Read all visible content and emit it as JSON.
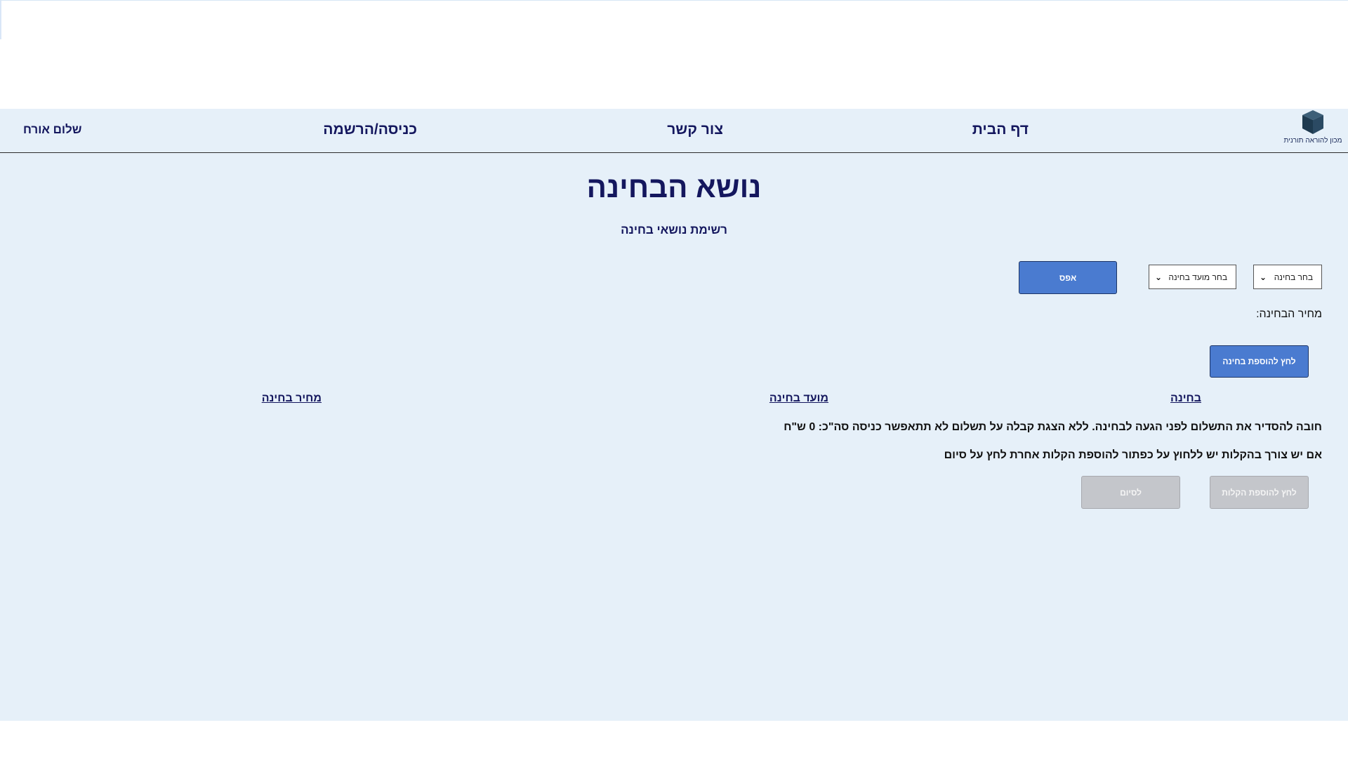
{
  "header": {
    "logo_text": "מכון להוראה תורנית",
    "nav": {
      "home": "דף הבית",
      "contact": "צור קשר",
      "login": "כניסה/הרשמה"
    },
    "greeting": "שלום אורח"
  },
  "main": {
    "title": "נושא הבחינה",
    "subtitle": "רשימת נושאי בחינה",
    "select_exam": {
      "value": "בחר בחינה"
    },
    "select_date": {
      "value": "בחר מועד בחינה"
    },
    "reset_label": "אפס",
    "price_label": "מחיר הבחינה:",
    "add_exam_label": "לחץ להוספת בחינה",
    "columns": [
      "בחינה",
      "מועד בחינה",
      "מחיר בחינה"
    ],
    "payment_notice": "חובה להסדיר את התשלום לפני הגעה לבחינה. ללא הצגת קבלה על תשלום לא תתאפשר כניסה סה\"כ: 0 ש\"ח",
    "ease_notice": "אם יש צורך בהקלות יש ללחוץ על כפתור להוספת הקלות אחרת לחץ על סיום",
    "add_ease_label": "לחץ להוספת הקלות",
    "finish_label": "לסיום"
  },
  "colors": {
    "background": "#e6f0f9",
    "navy_text": "#14175e",
    "primary_button": "#4a7bd0",
    "disabled_button": "#c4c6cb"
  }
}
